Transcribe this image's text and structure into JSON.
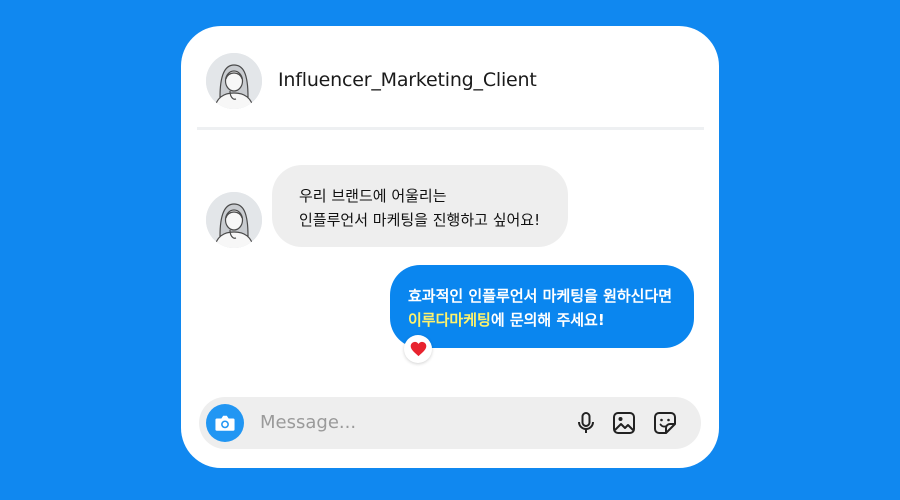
{
  "header": {
    "username": "Influencer_Marketing_Client",
    "avatar_icon": "woman-avatar-icon"
  },
  "messages": {
    "incoming": {
      "line1": "우리 브랜드에 어울리는",
      "line2": "인플루언서 마케팅을 진행하고 싶어요!"
    },
    "outgoing": {
      "line1": "효과적인 인플루언서 마케팅을 원하신다면",
      "line2_highlight": "이루다마케팅",
      "line2_rest": "에 문의해 주세요!",
      "reaction": "heart-icon"
    }
  },
  "composer": {
    "placeholder": "Message...",
    "icons": [
      "camera-icon",
      "microphone-icon",
      "gallery-icon",
      "sticker-icon"
    ]
  },
  "colors": {
    "background": "#1088f0",
    "outgoing_bubble": "#0a86ef",
    "incoming_bubble": "#eeeeee",
    "highlight": "#fff36b",
    "camera_button": "#2196f3"
  }
}
